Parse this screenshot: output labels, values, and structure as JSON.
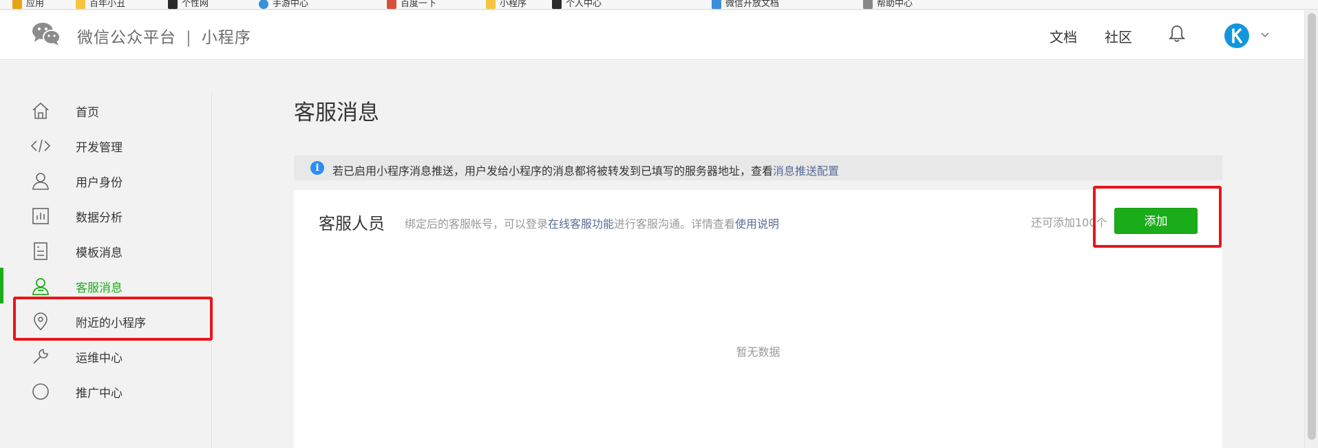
{
  "bookmarks": [
    {
      "label": "应用",
      "color": "#e8a317"
    },
    {
      "label": "百年小丑",
      "color": "#f5c542"
    },
    {
      "label": "个性网",
      "color": "#2a2a2a"
    },
    {
      "label": "手游中心",
      "color": "#3a8fd9"
    },
    {
      "label": "百度一下",
      "color": "#d94f3a"
    },
    {
      "label": "小程序",
      "color": "#f5c542"
    },
    {
      "label": "个人中心",
      "color": "#2a2a2a"
    },
    {
      "label": "微信开放文档",
      "color": "#3a8fd9"
    },
    {
      "label": "帮助中心",
      "color": "#888888"
    }
  ],
  "header": {
    "brand": "微信公众平台",
    "separator": "|",
    "product": "小程序",
    "links": [
      "文档",
      "社区"
    ],
    "bell_icon": "bell-icon",
    "avatar_icon": "avatar",
    "brand_color": "#1aad19"
  },
  "sidebar": {
    "items": [
      {
        "label": "首页",
        "icon": "home-icon",
        "active": false
      },
      {
        "label": "开发管理",
        "icon": "code-icon",
        "active": false
      },
      {
        "label": "用户身份",
        "icon": "user-icon",
        "active": false
      },
      {
        "label": "数据分析",
        "icon": "chart-icon",
        "active": false
      },
      {
        "label": "模板消息",
        "icon": "document-icon",
        "active": false
      },
      {
        "label": "客服消息",
        "icon": "service-icon",
        "active": true
      },
      {
        "label": "附近的小程序",
        "icon": "location-icon",
        "active": false
      },
      {
        "label": "运维中心",
        "icon": "wrench-icon",
        "active": false
      },
      {
        "label": "推广中心",
        "icon": "promotion-icon",
        "active": false
      }
    ]
  },
  "main": {
    "title": "客服消息",
    "notice": {
      "text": "若已启用小程序消息推送，用户发给小程序的消息都将被转发到已填写的服务器地址，查看",
      "link": "消息推送配置"
    },
    "card": {
      "title": "客服人员",
      "desc_prefix": "绑定后的客服帐号，可以登录",
      "desc_link1": "在线客服功能",
      "desc_middle": "进行客服沟通。详情查看",
      "desc_link2": "使用说明",
      "quota": "还可添加100个",
      "add_button": "添加",
      "empty_text": "暂无数据"
    }
  },
  "highlight_color": "#e8151a",
  "accent_color": "#1aad19"
}
